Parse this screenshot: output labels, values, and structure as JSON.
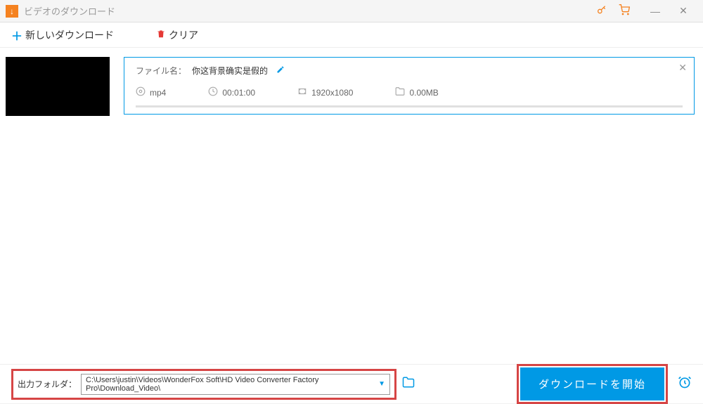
{
  "window": {
    "title": "ビデオのダウンロード"
  },
  "toolbar": {
    "newDownload": "新しいダウンロード",
    "clear": "クリア"
  },
  "item": {
    "fileNameLabel": "ファイル名：",
    "fileName": "你这背景确实是假的",
    "format": "mp4",
    "duration": "00:01:00",
    "resolution": "1920x1080",
    "size": "0.00MB"
  },
  "output": {
    "label": "出力フォルダ：",
    "path": "C:\\Users\\justin\\Videos\\WonderFox Soft\\HD Video Converter Factory Pro\\Download_Video\\"
  },
  "actions": {
    "startDownload": "ダウンロードを開始"
  }
}
